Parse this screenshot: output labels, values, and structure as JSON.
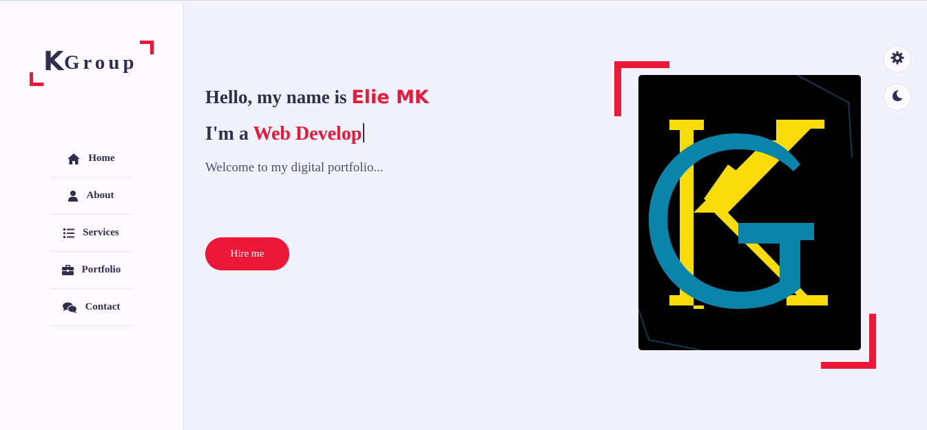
{
  "logo": {
    "letter": "K",
    "word": "Group"
  },
  "nav": {
    "items": [
      {
        "label": "Home",
        "icon": "home-icon"
      },
      {
        "label": "About",
        "icon": "user-icon"
      },
      {
        "label": "Services",
        "icon": "list-icon"
      },
      {
        "label": "Portfolio",
        "icon": "briefcase-icon"
      },
      {
        "label": "Contact",
        "icon": "comments-icon"
      }
    ]
  },
  "hero": {
    "greeting": "Hello, my name is ",
    "name": "Elie MK",
    "role_prefix": "I'm a ",
    "role_typed": "Web Develop",
    "welcome": "Welcome to my digital portfolio...",
    "hire_label": "Hire me"
  },
  "profile_image": {
    "alt": "KG logo",
    "colors": {
      "background": "#000000",
      "g_letter": "#0a84a8",
      "k_letter": "#f7dc0a"
    }
  },
  "controls": {
    "settings_icon": "gear-icon",
    "theme_icon": "moon-icon"
  },
  "colors": {
    "accent": "#ec1839",
    "text_dark": "#302e4d",
    "text_muted": "#504e70",
    "page_bg": "#f2f2fc",
    "sidebar_bg": "#fdf9ff"
  }
}
